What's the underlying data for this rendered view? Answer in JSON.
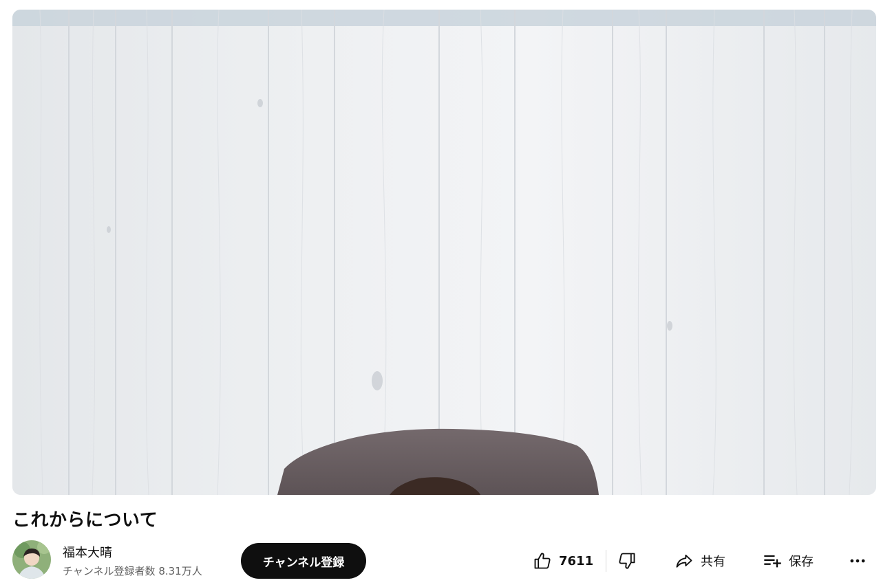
{
  "video": {
    "title": "これからについて"
  },
  "channel": {
    "name": "福本大晴",
    "subscribers": "チャンネル登録者数 8.31万人",
    "avatar_icon": "channel-avatar"
  },
  "subscribe": {
    "label": "チャンネル登録"
  },
  "actions": {
    "like_count": "7611",
    "like_icon": "thumbs-up-icon",
    "dislike_icon": "thumbs-down-icon",
    "share_label": "共有",
    "share_icon": "share-arrow-icon",
    "save_label": "保存",
    "save_icon": "playlist-add-icon",
    "more_icon": "more-horizontal-icon"
  },
  "colors": {
    "subscribe_bg": "#0f0f0f",
    "text_primary": "#0f0f0f",
    "text_secondary": "#606060"
  }
}
